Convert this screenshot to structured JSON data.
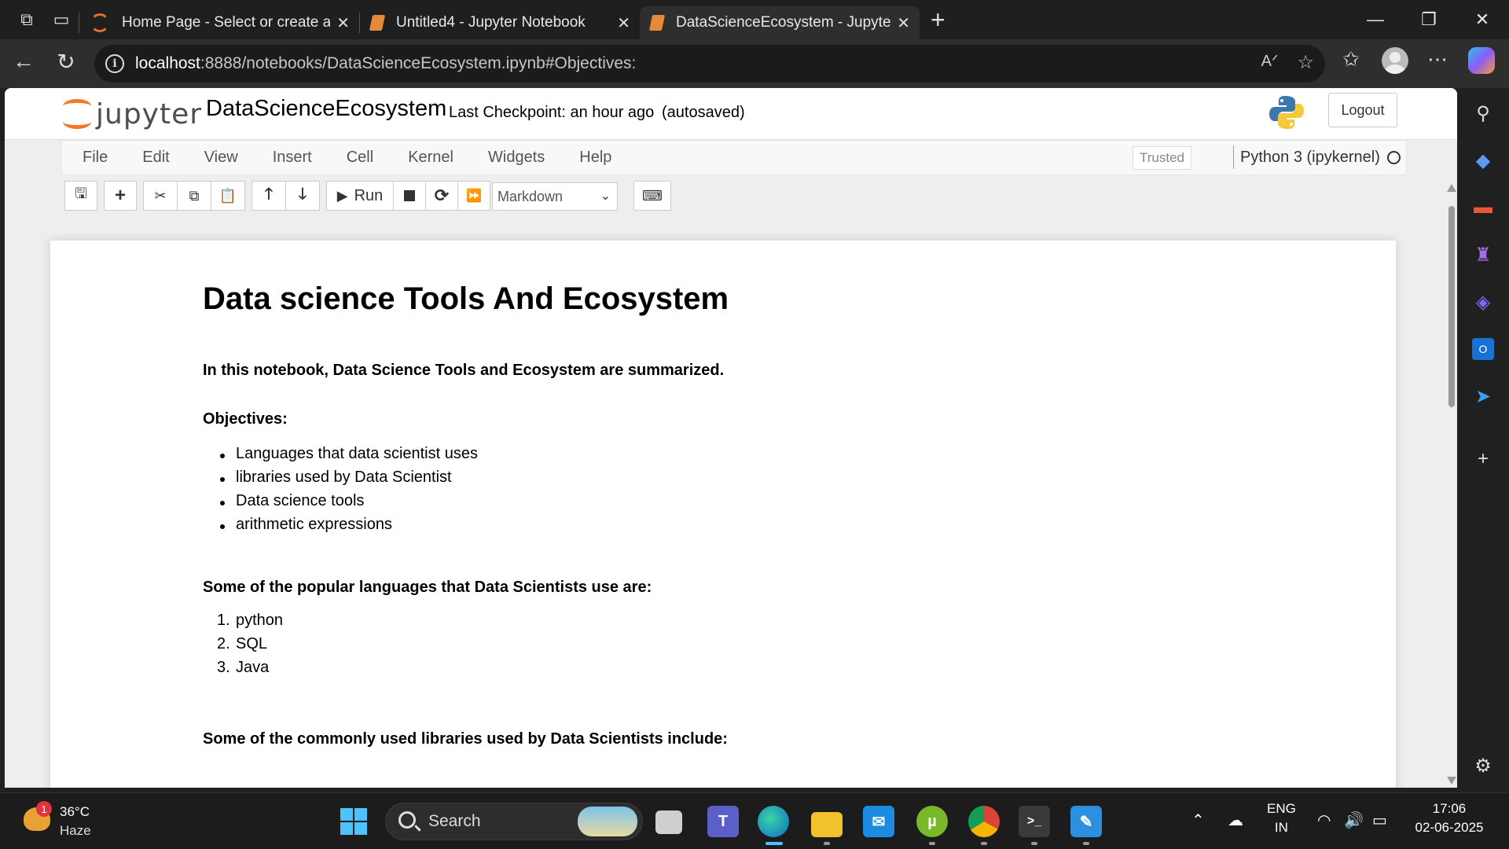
{
  "browser": {
    "tabs": [
      {
        "title": "Home Page - Select or create a notebook",
        "close": "✕",
        "icon": "jupyter-spinner-icon"
      },
      {
        "title": "Untitled4 - Jupyter Notebook",
        "close": "✕",
        "icon": "notebook-icon"
      },
      {
        "title": "DataScienceEcosystem - Jupyter Notebook",
        "close": "✕",
        "icon": "notebook-icon"
      }
    ],
    "new_tab": "+",
    "url_host": "localhost",
    "url_path": ":8888/notebooks/DataScienceEcosystem.ipynb#Objectives:",
    "window": {
      "minimize": "—",
      "restore": "❐",
      "close": "✕"
    }
  },
  "jupyter": {
    "logo_text": "jupyter",
    "notebook_name": "DataScienceEcosystem",
    "checkpoint": "Last Checkpoint: an hour ago",
    "autosave": "(autosaved)",
    "logout": "Logout",
    "menu": [
      "File",
      "Edit",
      "View",
      "Insert",
      "Cell",
      "Kernel",
      "Widgets",
      "Help"
    ],
    "trusted": "Trusted",
    "kernel": "Python 3 (ipykernel)",
    "toolbar": {
      "run_label": "Run",
      "cell_type": "Markdown"
    }
  },
  "notebook": {
    "title": "Data science Tools And Ecosystem",
    "intro": "In this notebook, Data Science Tools and Ecosystem are summarized.",
    "objectives_heading": "Objectives:",
    "objectives": [
      "Languages that data scientist uses",
      "libraries used by Data Scientist",
      "Data science tools",
      "arithmetic expressions"
    ],
    "languages_heading": "Some of the popular languages that Data Scientists use are:",
    "languages": [
      "python",
      "SQL",
      "Java"
    ],
    "libraries_heading": "Some of the commonly used libraries used by Data Scientists include:"
  },
  "taskbar": {
    "temperature": "36°C",
    "weather": "Haze",
    "weather_badge": "1",
    "search_label": "Search",
    "lang_1": "ENG",
    "lang_2": "IN",
    "time": "17:06",
    "date": "02-06-2025"
  },
  "colors": {
    "jupyter_orange": "#f37726",
    "browser_dark": "#1f1f1f",
    "accent_blue": "#2b88d8"
  }
}
